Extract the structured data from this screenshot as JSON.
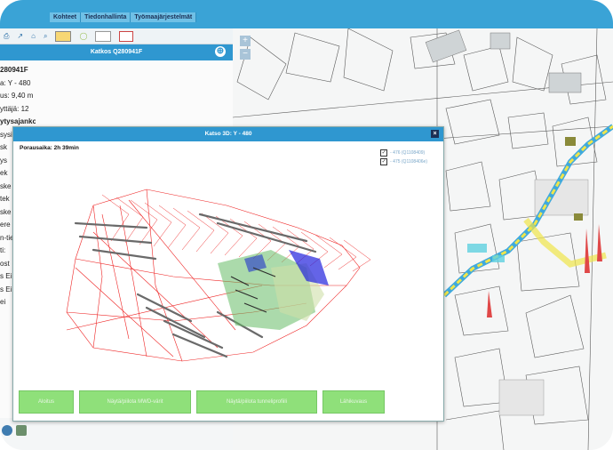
{
  "menu": {
    "items": [
      "Kohteet",
      "Tiedonhallinta",
      "Työmaajärjestelmät"
    ]
  },
  "toolbar": {
    "icons": [
      "print-icon",
      "measure-icon",
      "home-icon",
      "zoom-icon",
      "layer-icon",
      "circle-icon",
      "blank-icon",
      "calendar-icon"
    ]
  },
  "left_panel": {
    "title": "Katkos Q280941F",
    "lines": [
      {
        "text": "280941F",
        "bold": true
      },
      {
        "text": "a: Y - 480",
        "bold": false
      },
      {
        "text": "us: 9,40 m",
        "bold": false
      },
      {
        "text": "yttäjä: 12",
        "bold": false
      },
      {
        "text": "ytysajankohta:",
        "bold": true
      },
      {
        "text": "sysi",
        "bold": false
      },
      {
        "text": "sk",
        "bold": false
      },
      {
        "text": "ys",
        "bold": false
      },
      {
        "text": "ek",
        "bold": false
      },
      {
        "text": "ske",
        "bold": false
      },
      {
        "text": "tek",
        "bold": false
      },
      {
        "text": "ske",
        "bold": false
      },
      {
        "text": "ere",
        "bold": false
      },
      {
        "text": "n-tie",
        "bold": false
      },
      {
        "text": "ti:",
        "bold": false
      },
      {
        "text": "ost",
        "bold": false
      },
      {
        "text": "s Ei",
        "bold": false
      },
      {
        "text": "s Ei",
        "bold": false
      },
      {
        "text": "ei",
        "bold": false
      }
    ]
  },
  "zoom": {
    "in": "+",
    "out": "−"
  },
  "dialog": {
    "title": "Katso 3D: Y - 480",
    "close": "×",
    "time_label": "Porausaika: 2h 39min",
    "legend": [
      {
        "checked": "✓",
        "label": "- 476 (Q1108409)"
      },
      {
        "checked": "✓",
        "label": "- 475 (Q1108406e)"
      }
    ],
    "buttons": [
      "Aloitus",
      "Näytä/piilota MWD-värit",
      "Näytä/piilota tunneliprofiili",
      "Lähikuvaus"
    ],
    "colors": {
      "wireframe": "#ee2222",
      "holes": "#707070",
      "zone_green": "#66bb66",
      "zone_blue": "#2222dd"
    }
  }
}
